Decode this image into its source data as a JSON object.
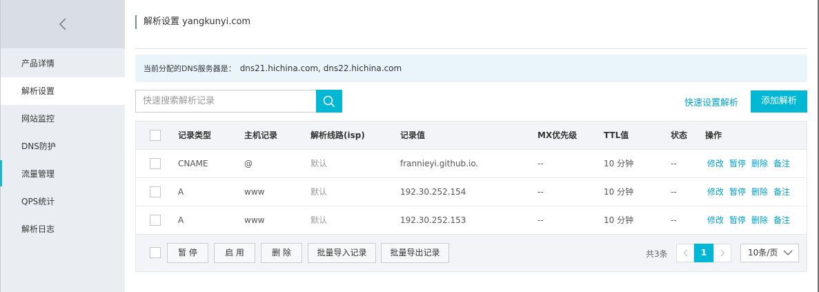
{
  "sidebar": {
    "back_icon": "chevron-left-icon",
    "items": [
      {
        "label": "产品详情"
      },
      {
        "label": "解析设置"
      },
      {
        "label": "网站监控"
      },
      {
        "label": "DNS防护"
      },
      {
        "label": "流量管理"
      },
      {
        "label": "QPS统计"
      },
      {
        "label": "解析日志"
      }
    ],
    "active_index": 1
  },
  "header": {
    "title": "解析设置 yangkunyi.com"
  },
  "notice": {
    "label": "当前分配的DNS服务器是：",
    "servers": "dns21.hichina.com, dns22.hichina.com"
  },
  "search": {
    "placeholder": "快速搜索解析记录",
    "icon": "search-icon"
  },
  "toolbar": {
    "quick_setup": "快速设置解析",
    "add": "添加解析"
  },
  "table": {
    "headers": {
      "type": "记录类型",
      "host": "主机记录",
      "line": "解析线路(isp)",
      "value": "记录值",
      "mx": "MX优先级",
      "ttl": "TTL值",
      "status": "状态",
      "ops": "操作"
    },
    "rows": [
      {
        "type": "CNAME",
        "host": "@",
        "line": "默认",
        "value": "frannieyi.github.io.",
        "mx": "--",
        "ttl": "10 分钟",
        "status": "--"
      },
      {
        "type": "A",
        "host": "www",
        "line": "默认",
        "value": "192.30.252.154",
        "mx": "--",
        "ttl": "10 分钟",
        "status": "--"
      },
      {
        "type": "A",
        "host": "www",
        "line": "默认",
        "value": "192.30.252.153",
        "mx": "--",
        "ttl": "10 分钟",
        "status": "--"
      }
    ],
    "actions": {
      "edit": "修改",
      "pause": "暂停",
      "delete": "删除",
      "note": "备注"
    }
  },
  "footer": {
    "buttons": {
      "pause": "暂 停",
      "enable": "启 用",
      "delete": "删 除",
      "import": "批量导入记录",
      "export": "批量导出记录"
    },
    "total": "共3条",
    "current_page": "1",
    "per_page": "10条/页"
  },
  "colors": {
    "accent": "#00b8d4",
    "link": "#00a2ca"
  }
}
